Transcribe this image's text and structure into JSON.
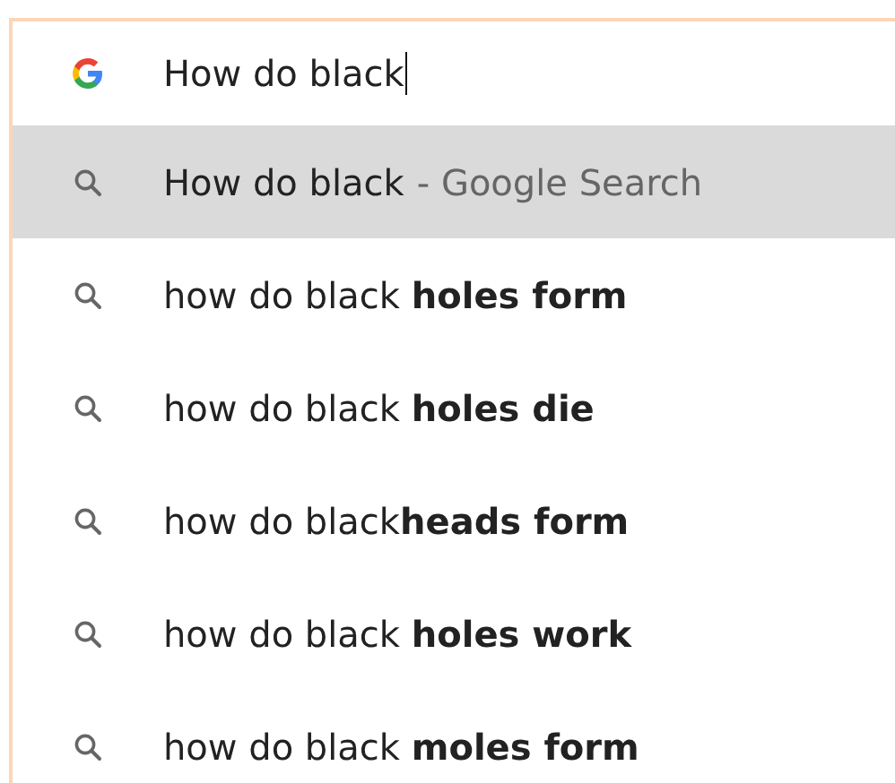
{
  "omnibox": {
    "value": "How do black"
  },
  "suggestions": [
    {
      "text": "How do black",
      "suffix": "- Google Search",
      "selected": true
    },
    {
      "text": "how do black **holes form**",
      "selected": false
    },
    {
      "text": "how do black **holes die**",
      "selected": false
    },
    {
      "text": "how do black**heads form**",
      "selected": false
    },
    {
      "text": "how do black **holes work**",
      "selected": false
    },
    {
      "text": "how do black **moles form**",
      "selected": false
    }
  ]
}
